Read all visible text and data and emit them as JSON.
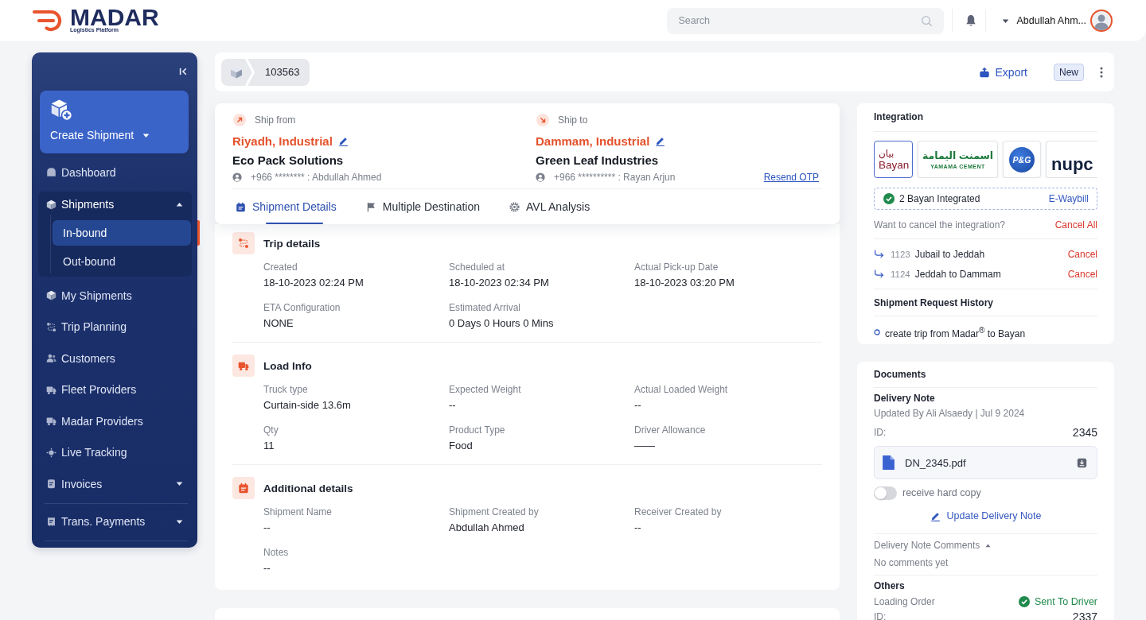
{
  "header": {
    "logo": {
      "name": "MADAR",
      "tagline": "Logistics Platform"
    },
    "search": {
      "placeholder": "Search"
    },
    "user": {
      "name": "Abdullah Ahm..."
    }
  },
  "sidebar": {
    "create_button": {
      "label": "Create Shipment"
    },
    "items": [
      {
        "label": "Dashboard",
        "kind": "link",
        "selected": false
      },
      {
        "label": "Shipments",
        "kind": "menu",
        "selected": false,
        "expanded": true,
        "children": [
          {
            "label": "In-bound",
            "selected": true
          },
          {
            "label": "Out-bound",
            "selected": false
          }
        ]
      },
      {
        "label": "My Shipments",
        "kind": "link",
        "selected": false
      },
      {
        "label": "Trip Planning",
        "kind": "link",
        "selected": false
      },
      {
        "label": "Customers",
        "kind": "link",
        "selected": false
      },
      {
        "label": "Fleet Providers",
        "kind": "link",
        "selected": false
      },
      {
        "label": "Madar Providers",
        "kind": "link",
        "selected": false
      },
      {
        "label": "Live Tracking",
        "kind": "link",
        "selected": false
      },
      {
        "label": "Invoices",
        "kind": "menu",
        "selected": false,
        "expanded": false
      },
      {
        "label": "Trans. Payments",
        "kind": "menu",
        "selected": false,
        "expanded": false
      }
    ]
  },
  "toolbar": {
    "breadcrumb": [
      "103563"
    ],
    "export": {
      "label": "Export"
    },
    "status": "New"
  },
  "route": {
    "ship_from": {
      "caption": "Ship from",
      "city": "Riyadh, Industrial",
      "company": "Eco Pack Solutions",
      "contact": "+966 ******** : Abdullah Ahmed"
    },
    "ship_to": {
      "caption": "Ship to",
      "city": "Dammam, Industrial",
      "company": "Green Leaf Industries",
      "contact": "+966 ********** : Rayan Arjun",
      "link": "Resend OTP"
    }
  },
  "tabs": [
    {
      "label": "Shipment Details",
      "selected": true
    },
    {
      "label": "Multiple Destination",
      "selected": false
    },
    {
      "label": "AVL Analysis",
      "selected": false
    }
  ],
  "sections": [
    {
      "title": "Trip details",
      "fields": [
        {
          "label": "Created",
          "value": "18-10-2023 02:24 PM"
        },
        {
          "label": "Scheduled at",
          "value": "18-10-2023 02:34 PM"
        },
        {
          "label": "Actual Pick-up Date",
          "value": "18-10-2023 03:20 PM"
        },
        {
          "label": "ETA Configuration",
          "value": "NONE"
        },
        {
          "label": "Estimated Arrival",
          "value": "0 Days 0 Hours 0 Mins"
        }
      ]
    },
    {
      "title": "Load Info",
      "fields": [
        {
          "label": "Truck type",
          "value": "Curtain-side 13.6m"
        },
        {
          "label": "Expected Weight",
          "value": "--"
        },
        {
          "label": "Actual Loaded Weight",
          "value": "--"
        },
        {
          "label": "Qty",
          "value": "11"
        },
        {
          "label": "Product Type",
          "value": "Food"
        },
        {
          "label": "Driver Allowance",
          "value": "——"
        }
      ]
    },
    {
      "title": "Additional details",
      "fields": [
        {
          "label": "Shipment Name",
          "value": "--"
        },
        {
          "label": "Shipment Created by",
          "value": "Abdullah Ahmed"
        },
        {
          "label": "Receiver Created by",
          "value": "--"
        },
        {
          "label": "Notes",
          "value": "--"
        }
      ]
    }
  ],
  "integration": {
    "title": "Integration",
    "partners": [
      {
        "kind": "bilingual",
        "lines": [
          "بيان",
          "Bayan"
        ],
        "selected": true
      },
      {
        "kind": "stacked",
        "lines": [
          "اسمنت اليمامة",
          "YAMAMA CEMENT"
        ],
        "selected": false
      },
      {
        "kind": "emblem",
        "lines": [
          "P&G"
        ],
        "selected": false
      },
      {
        "kind": "wordmark",
        "lines": [
          "nupc"
        ],
        "selected": false
      }
    ],
    "status": {
      "text": "2 Bayan Integrated",
      "link": "E-Waybill"
    },
    "cancel": {
      "text": "Want to cancel the integration?",
      "action": "Cancel All"
    },
    "trips": [
      {
        "id": "1123",
        "route": "Jubail to Jeddah",
        "action": "Cancel"
      },
      {
        "id": "1124",
        "route": "Jeddah to Dammam",
        "action": "Cancel"
      }
    ],
    "history": {
      "title": "Shipment Request History",
      "entries": [
        "create trip from Madar$^{®}$ to Bayan"
      ]
    }
  },
  "documents": {
    "title": "Documents",
    "delivery_note": {
      "title": "Delivery Note",
      "updated": "Updated By Ali Alsaedy | Jul 9 2024",
      "id_label": "ID:",
      "id": "2345",
      "file": "DN_2345.pdf",
      "hard_copy": {
        "label": "receive hard copy",
        "on": false
      },
      "update_link": "Update Delivery Note",
      "comments": {
        "label": "Delivery Note Comments",
        "expanded": true,
        "empty": "No comments yet"
      }
    },
    "others": {
      "title": "Others",
      "items": [
        {
          "label": "Loading Order",
          "status": "Sent To Driver",
          "id_label": "ID:",
          "id": "2337"
        }
      ]
    }
  }
}
